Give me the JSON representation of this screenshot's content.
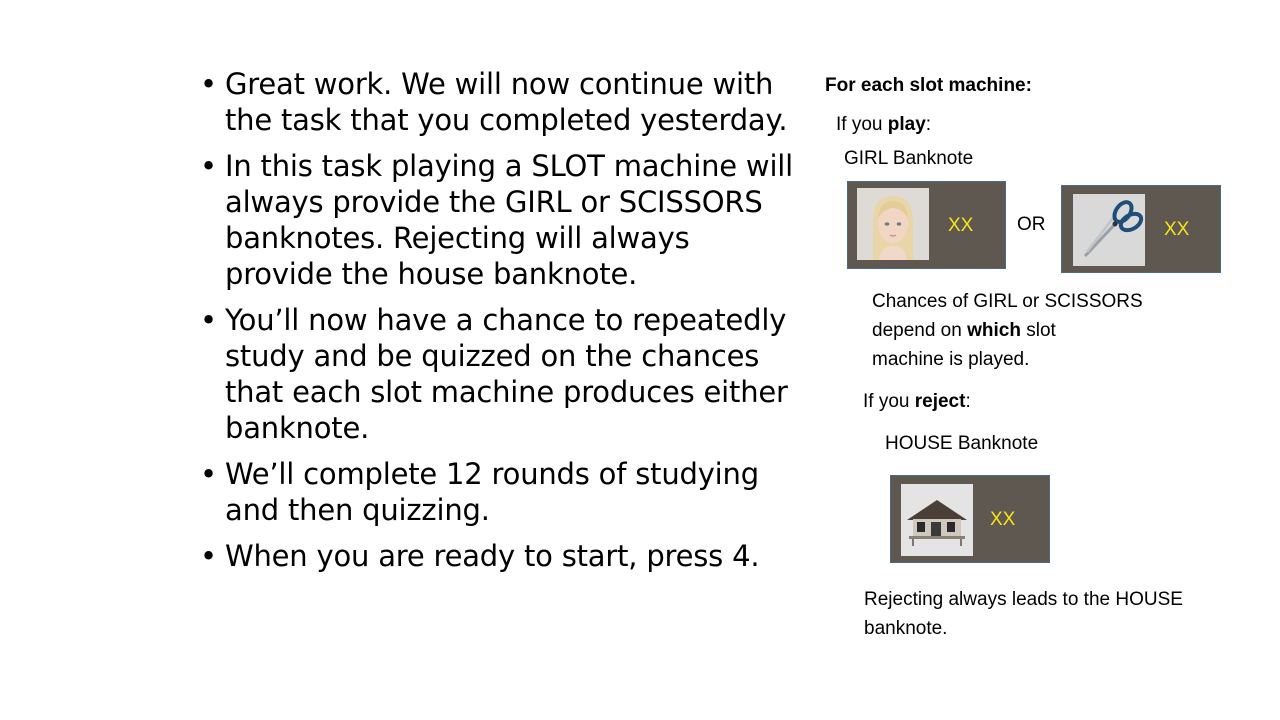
{
  "instructions": [
    "Great work. We will now continue with the task that you completed yesterday.",
    "In this task playing a SLOT machine will always provide the GIRL or SCISSORS banknotes. Rejecting will always provide the house banknote.",
    "You’ll now have a chance to repeatedly study and be quizzed on the chances that each slot machine produces either banknote.",
    "We’ll complete 12 rounds of studying and then quizzing.",
    "When you are ready to start, press 4."
  ],
  "panel": {
    "heading": "For each slot machine:",
    "play_prefix": "If you ",
    "play_word": "play",
    "play_suffix": ":",
    "girl_label": "GIRL Banknote",
    "girl_value": "XX",
    "or_label": "OR",
    "scissors_value": "XX",
    "chances_line1": "Chances of GIRL or SCISSORS",
    "chances_line2_pre": "depend on ",
    "chances_line2_bold": "which",
    "chances_line2_post": " slot",
    "chances_line3": "machine is played.",
    "reject_prefix": "If you ",
    "reject_word": "reject",
    "reject_suffix": ":",
    "house_label": "HOUSE Banknote",
    "house_value": "XX",
    "rejecting_line1": "Rejecting always leads to the HOUSE",
    "rejecting_line2": "banknote."
  },
  "colors": {
    "banknote_bg": "#5e5850",
    "banknote_value": "#f6e31a"
  },
  "icons": [
    "bullet-dot",
    "girl-portrait-image",
    "scissors-icon",
    "house-image"
  ]
}
